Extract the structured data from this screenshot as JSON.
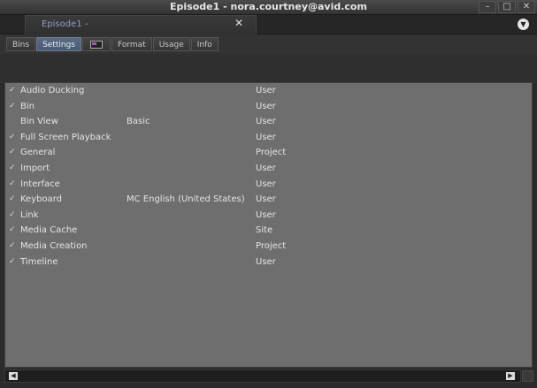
{
  "window": {
    "title": "Episode1 - nora.courtney@avid.com"
  },
  "tab": {
    "label": "Episode1 -",
    "close_glyph": "✕"
  },
  "subtabs": [
    {
      "label": "Bins"
    },
    {
      "label": "Settings"
    },
    {
      "label": ""
    },
    {
      "label": "Format"
    },
    {
      "label": "Usage"
    },
    {
      "label": "Info"
    }
  ],
  "settings": [
    {
      "checked": "✓",
      "name": "Audio Ducking",
      "value": "",
      "scope": "User"
    },
    {
      "checked": "✓",
      "name": "Bin",
      "value": "",
      "scope": "User"
    },
    {
      "checked": "",
      "name": "Bin View",
      "value": "Basic",
      "scope": "User"
    },
    {
      "checked": "✓",
      "name": "Full Screen Playback",
      "value": "",
      "scope": "User"
    },
    {
      "checked": "✓",
      "name": "General",
      "value": "",
      "scope": "Project"
    },
    {
      "checked": "✓",
      "name": "Import",
      "value": "",
      "scope": "User"
    },
    {
      "checked": "✓",
      "name": "Interface",
      "value": "",
      "scope": "User"
    },
    {
      "checked": "✓",
      "name": "Keyboard",
      "value": "MC English (United States)",
      "scope": "User"
    },
    {
      "checked": "✓",
      "name": "Link",
      "value": "",
      "scope": "User"
    },
    {
      "checked": "✓",
      "name": "Media Cache",
      "value": "",
      "scope": "Site"
    },
    {
      "checked": "✓",
      "name": "Media Creation",
      "value": "",
      "scope": "Project"
    },
    {
      "checked": "✓",
      "name": "Timeline",
      "value": "",
      "scope": "User"
    }
  ],
  "icons": {
    "minimize": "minimize-icon",
    "maximize": "maximize-icon",
    "close": "close-icon",
    "menu": "chevron-down-icon",
    "scroll_left": "arrow-left-icon",
    "scroll_right": "arrow-right-icon"
  }
}
